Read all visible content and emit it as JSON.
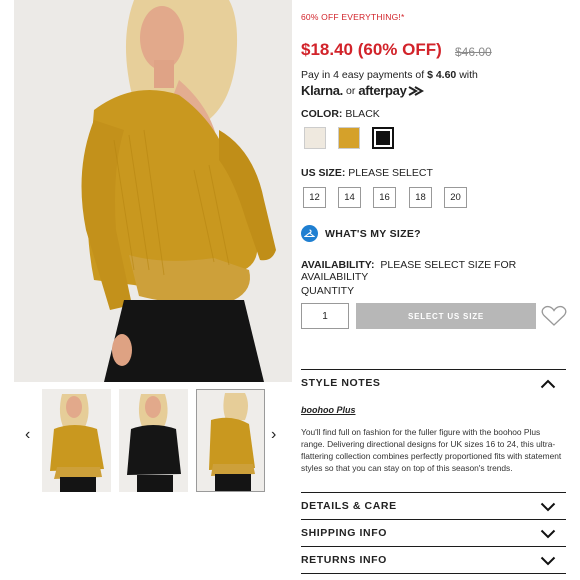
{
  "promo_banner": "60% OFF EVERYTHING!*",
  "price": {
    "current": "$18.40 (60% OFF)",
    "original": "$46.00"
  },
  "installments": {
    "text_prefix": "Pay in 4 easy payments of",
    "amount": "$ 4.60",
    "text_suffix": "with",
    "klarna_label": "Klarna.",
    "or_label": "or",
    "afterpay_label": "afterpay"
  },
  "color": {
    "label": "COLOR:",
    "selected": "BLACK",
    "swatches": [
      {
        "name": "cream",
        "hex": "#efe9df"
      },
      {
        "name": "mustard",
        "hex": "#d5a12a"
      },
      {
        "name": "black",
        "hex": "#111111"
      }
    ]
  },
  "size": {
    "label": "US SIZE:",
    "prompt": "PLEASE SELECT",
    "options": [
      "12",
      "14",
      "16",
      "18",
      "20"
    ]
  },
  "whats_my_size": "WHAT'S MY SIZE?",
  "availability": {
    "label": "AVAILABILITY:",
    "value": "PLEASE SELECT SIZE FOR AVAILABILITY"
  },
  "quantity": {
    "label": "QUANTITY",
    "value": "1"
  },
  "add_button_label": "SELECT US SIZE",
  "style_notes": {
    "title": "STYLE NOTES",
    "brand_link": "boohoo Plus",
    "description": "You'll find full on fashion for the fuller figure with the boohoo Plus range. Delivering directional designs for UK sizes 16 to 24, this ultra-flattering collection combines perfectly proportioned fits with statement styles so that you can stay on top of this season's trends."
  },
  "accordions": [
    {
      "title": "DETAILS & CARE"
    },
    {
      "title": "SHIPPING INFO"
    },
    {
      "title": "RETURNS INFO"
    }
  ],
  "colors": {
    "sale_red": "#d2232a",
    "mustard": "#c9981f",
    "size_help_blue": "#1f7fd1",
    "disabled_button": "#b7b7b7"
  }
}
